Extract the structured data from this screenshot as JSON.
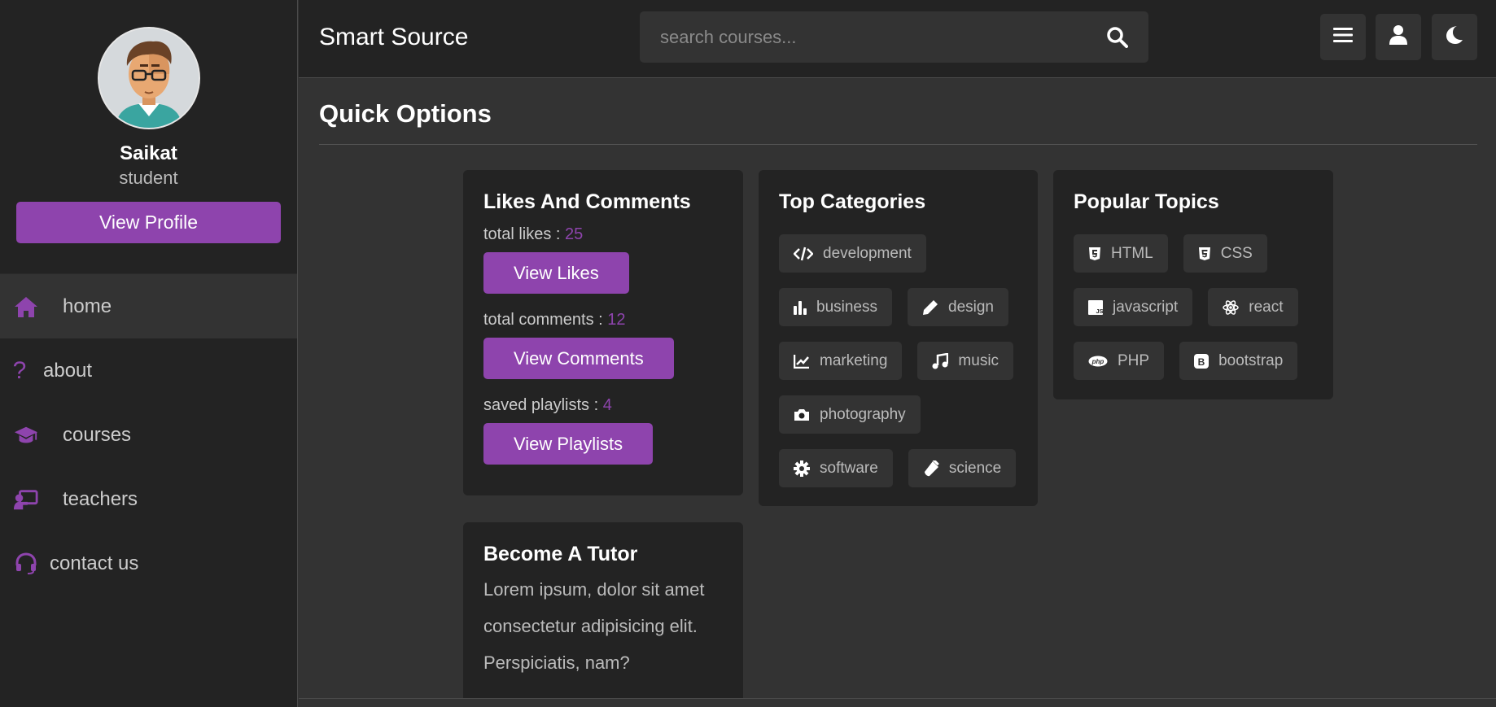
{
  "app": {
    "title": "Smart Source"
  },
  "profile": {
    "name": "Saikat",
    "role": "student",
    "view_profile_label": "View Profile",
    "avatar_icon": "avatar-icon"
  },
  "nav": {
    "items": [
      {
        "label": "home",
        "icon": "home-icon",
        "active": true
      },
      {
        "label": "about",
        "icon": "question-icon"
      },
      {
        "label": "courses",
        "icon": "graduation-cap-icon"
      },
      {
        "label": "teachers",
        "icon": "chalkboard-teacher-icon"
      },
      {
        "label": "contact us",
        "icon": "headset-icon"
      }
    ]
  },
  "search": {
    "placeholder": "search courses...",
    "value": ""
  },
  "header_buttons": [
    "menu-icon",
    "user-icon",
    "moon-icon"
  ],
  "main": {
    "heading": "Quick Options"
  },
  "likes_card": {
    "title": "Likes And Comments",
    "likes_label": "total likes : ",
    "likes_value": "25",
    "likes_button": "View Likes",
    "comments_label": "total comments : ",
    "comments_value": "12",
    "comments_button": "View Comments",
    "playlists_label": "saved playlists : ",
    "playlists_value": "4",
    "playlists_button": "View Playlists"
  },
  "categories_card": {
    "title": "Top Categories",
    "items": [
      {
        "label": "development",
        "icon": "code-icon"
      },
      {
        "label": "business",
        "icon": "chart-simple-icon"
      },
      {
        "label": "design",
        "icon": "pen-icon"
      },
      {
        "label": "marketing",
        "icon": "chart-line-icon"
      },
      {
        "label": "music",
        "icon": "music-icon"
      },
      {
        "label": "photography",
        "icon": "camera-icon"
      },
      {
        "label": "software",
        "icon": "cog-icon"
      },
      {
        "label": "science",
        "icon": "vial-icon"
      }
    ]
  },
  "topics_card": {
    "title": "Popular Topics",
    "items": [
      {
        "label": "HTML",
        "icon": "html5-icon"
      },
      {
        "label": "CSS",
        "icon": "css3-icon"
      },
      {
        "label": "javascript",
        "icon": "js-icon"
      },
      {
        "label": "react",
        "icon": "react-icon"
      },
      {
        "label": "PHP",
        "icon": "php-icon"
      },
      {
        "label": "bootstrap",
        "icon": "bootstrap-icon"
      }
    ]
  },
  "tutor_card": {
    "title": "Become A Tutor",
    "text": "Lorem ipsum, dolor sit amet consectetur adipisicing elit. Perspiciatis, nam?"
  },
  "colors": {
    "accent": "#8e44ad",
    "sidebar_bg": "#232323",
    "main_bg": "#333333",
    "card_bg": "#232323"
  }
}
